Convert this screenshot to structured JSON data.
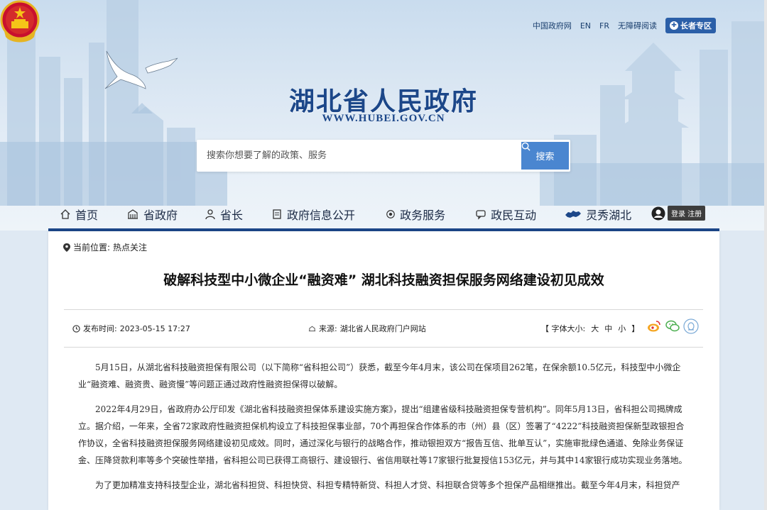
{
  "top_links": {
    "gov": "中国政府网",
    "en": "EN",
    "fr": "FR",
    "accessibility": "无障碍阅读",
    "elder": "长者专区"
  },
  "site": {
    "title": "湖北省人民政府",
    "url": "WWW.HUBEI.GOV.CN"
  },
  "search": {
    "placeholder": "搜索你想要了解的政策、服务",
    "button": "搜索"
  },
  "nav": {
    "items": [
      {
        "label": "首页",
        "icon": "home-icon"
      },
      {
        "label": "省政府",
        "icon": "building-icon"
      },
      {
        "label": "省长",
        "icon": "person-icon"
      },
      {
        "label": "政府信息公开",
        "icon": "document-icon"
      },
      {
        "label": "政务服务",
        "icon": "service-icon"
      },
      {
        "label": "政民互动",
        "icon": "chat-icon"
      },
      {
        "label": "灵秀湖北",
        "icon": "map-icon"
      }
    ],
    "login": "登录 注册"
  },
  "breadcrumb": {
    "prefix": "当前位置:",
    "current": "热点关注"
  },
  "article": {
    "title": "破解科技型中小微企业“融资难” 湖北科技融资担保服务网络建设初见成效",
    "publish_label": "发布时间:",
    "publish_time": "2023-05-15 17:27",
    "source_label": "来源:",
    "source": "湖北省人民政府门户网站",
    "font_size_label": "【 字体大小:",
    "font_large": "大",
    "font_medium": "中",
    "font_small": "小",
    "font_close": "】",
    "paragraphs": [
      "5月15日，从湖北省科技融资担保有限公司（以下简称“省科担公司”）获悉，截至今年4月末，该公司在保项目262笔，在保余额10.5亿元，科技型中小微企业“融资难、融资贵、融资慢”等问题正通过政府性融资担保得以破解。",
      "2022年4月29日，省政府办公厅印发《湖北省科技融资担保体系建设实施方案》，提出“组建省级科技融资担保专营机构”。同年5月13日，省科担公司揭牌成立。据介绍，一年来，全省72家政府性融资担保机构设立了科技担保事业部，70个再担保合作体系的市（州）县（区）签署了“4222”科技融资担保新型政银担合作协议，全省科技融资担保服务网络建设初见成效。同时，通过深化与银行的战略合作，推动银担双方“报告互信、批单互认”，实施审批绿色通道、免除业务保证金、压降贷款利率等多个突破性举措，省科担公司已获得工商银行、建设银行、省信用联社等17家银行批复授信153亿元，并与其中14家银行成功实现业务落地。",
      "为了更加精准支持科技型企业，湖北省科担贷、科担快贷、科担专精特新贷、科担人才贷、科担联合贷等多个担保产品相继推出。截至今年4月末，科担贷产"
    ]
  }
}
